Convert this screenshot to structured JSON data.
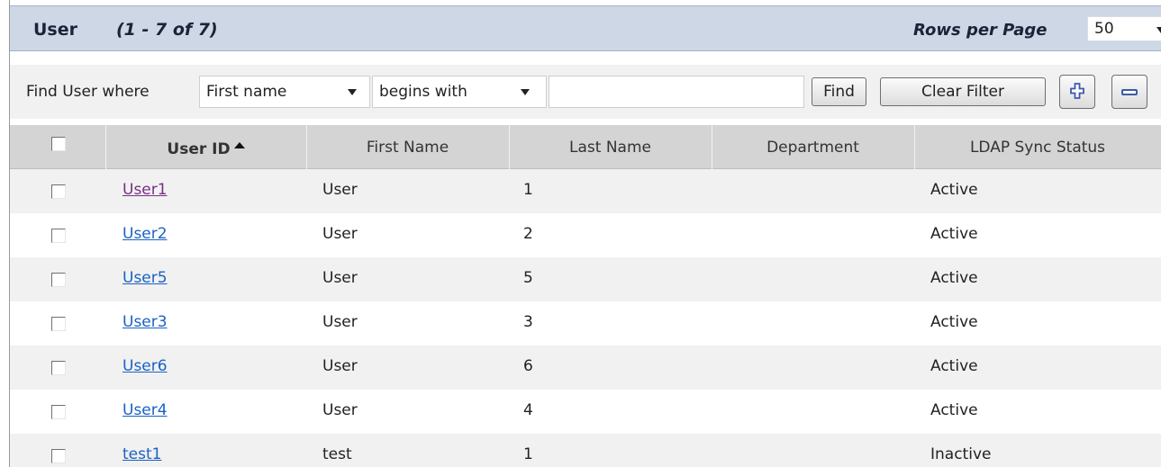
{
  "header": {
    "title": "User",
    "count": "(1 - 7 of 7)",
    "rows_per_page_label": "Rows per Page",
    "rows_per_page_value": "50"
  },
  "filter": {
    "label": "Find User where",
    "field_value": "First name",
    "operator_value": "begins with",
    "search_value": "",
    "find_label": "Find",
    "clear_label": "Clear Filter",
    "add_icon": "plus-icon",
    "remove_icon": "minus-icon"
  },
  "table": {
    "columns": [
      "User ID",
      "First Name",
      "Last Name",
      "Department",
      "LDAP Sync Status"
    ],
    "sorted_column": "User ID",
    "rows": [
      {
        "user_id": "User1",
        "first_name": "User",
        "last_name": "1",
        "department": "",
        "ldap": "Active"
      },
      {
        "user_id": "User2",
        "first_name": "User",
        "last_name": "2",
        "department": "",
        "ldap": "Active"
      },
      {
        "user_id": "User5",
        "first_name": "User",
        "last_name": "5",
        "department": "",
        "ldap": "Active"
      },
      {
        "user_id": "User3",
        "first_name": "User",
        "last_name": "3",
        "department": "",
        "ldap": "Active"
      },
      {
        "user_id": "User6",
        "first_name": "User",
        "last_name": "6",
        "department": "",
        "ldap": "Active"
      },
      {
        "user_id": "User4",
        "first_name": "User",
        "last_name": "4",
        "department": "",
        "ldap": "Active"
      },
      {
        "user_id": "test1",
        "first_name": "test",
        "last_name": "1",
        "department": "",
        "ldap": "Inactive"
      }
    ]
  },
  "colors": {
    "header_bg": "#cdd7e6",
    "link": "#1a62c6",
    "visited_link": "#7a2e86",
    "row_alt": "#f1f1f1"
  }
}
